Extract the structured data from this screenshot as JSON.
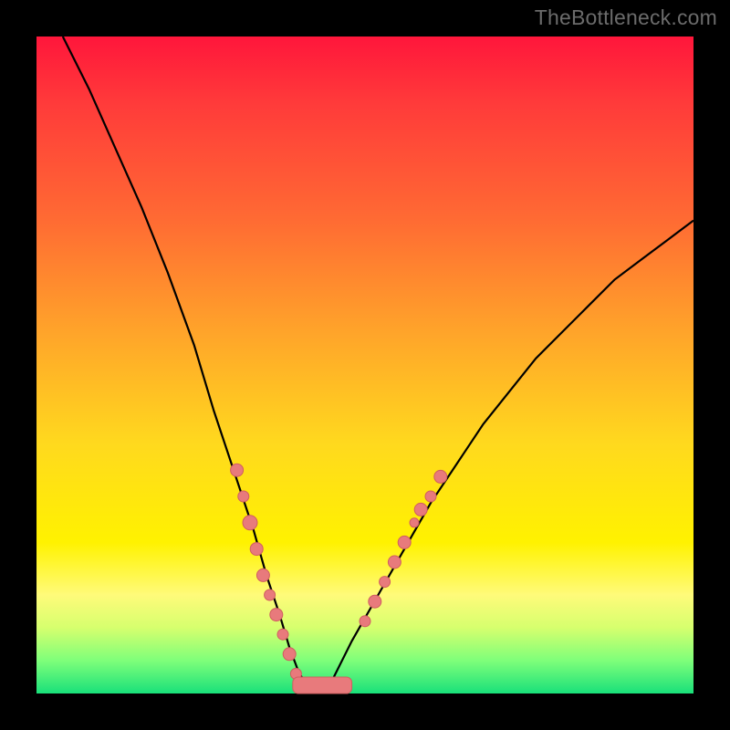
{
  "watermark": "TheBottleneck.com",
  "colors": {
    "gradient_top": "#ff163b",
    "gradient_bottom": "#19e07a",
    "curve": "#000000",
    "dots": "#e87a7c",
    "frame": "#000000"
  },
  "chart_data": {
    "type": "line",
    "title": "",
    "xlabel": "",
    "ylabel": "",
    "xlim": [
      0,
      100
    ],
    "ylim": [
      0,
      100
    ],
    "grid": false,
    "legend_position": "none",
    "series": [
      {
        "name": "bottleneck-curve",
        "x": [
          4,
          8,
          12,
          16,
          20,
          24,
          27,
          30,
          33,
          35,
          37,
          38.5,
          40,
          41.5,
          43,
          45,
          48,
          52,
          56,
          60,
          64,
          68,
          72,
          76,
          80,
          84,
          88,
          92,
          96,
          100
        ],
        "y": [
          100,
          92,
          83,
          74,
          64,
          53,
          43,
          34,
          25,
          18,
          12,
          7,
          3,
          1,
          0,
          2,
          8,
          15,
          22,
          29,
          35,
          41,
          46,
          51,
          55,
          59,
          63,
          66,
          69,
          72
        ]
      }
    ],
    "markers": [
      {
        "x": 30.5,
        "y": 34,
        "r": 7
      },
      {
        "x": 31.5,
        "y": 30,
        "r": 6
      },
      {
        "x": 32.5,
        "y": 26,
        "r": 8
      },
      {
        "x": 33.5,
        "y": 22,
        "r": 7
      },
      {
        "x": 34.5,
        "y": 18,
        "r": 7
      },
      {
        "x": 35.5,
        "y": 15,
        "r": 6
      },
      {
        "x": 36.5,
        "y": 12,
        "r": 7
      },
      {
        "x": 37.5,
        "y": 9,
        "r": 6
      },
      {
        "x": 38.5,
        "y": 6,
        "r": 7
      },
      {
        "x": 39.5,
        "y": 3,
        "r": 6
      },
      {
        "x": 50.0,
        "y": 11,
        "r": 6
      },
      {
        "x": 51.5,
        "y": 14,
        "r": 7
      },
      {
        "x": 53.0,
        "y": 17,
        "r": 6
      },
      {
        "x": 54.5,
        "y": 20,
        "r": 7
      },
      {
        "x": 56.0,
        "y": 23,
        "r": 7
      },
      {
        "x": 57.5,
        "y": 26,
        "r": 5
      },
      {
        "x": 58.5,
        "y": 28,
        "r": 7
      },
      {
        "x": 60.0,
        "y": 30,
        "r": 6
      },
      {
        "x": 61.5,
        "y": 33,
        "r": 7
      }
    ],
    "baseline_segment": {
      "x0": 39,
      "x1": 48,
      "y": 0,
      "height": 2.5
    }
  }
}
